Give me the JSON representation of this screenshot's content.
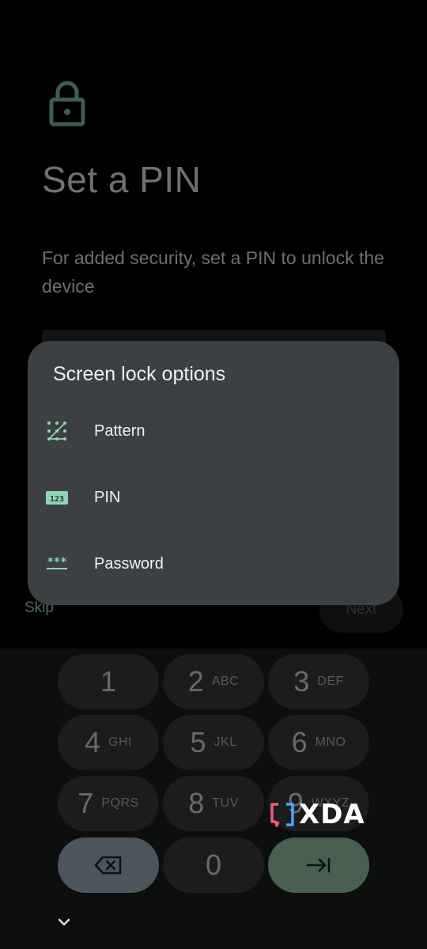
{
  "page": {
    "title": "Set a PIN",
    "description": "For added security, set a PIN to unlock the device",
    "skip_label": "Skip",
    "next_label": "Next"
  },
  "dialog": {
    "title": "Screen lock options",
    "options": [
      {
        "label": "Pattern",
        "icon": "pattern-icon"
      },
      {
        "label": "PIN",
        "icon": "pin-icon",
        "icon_text": "123"
      },
      {
        "label": "Password",
        "icon": "password-icon",
        "icon_text": "***"
      }
    ]
  },
  "keypad": {
    "keys": [
      {
        "digit": "1",
        "letters": ""
      },
      {
        "digit": "2",
        "letters": "ABC"
      },
      {
        "digit": "3",
        "letters": "DEF"
      },
      {
        "digit": "4",
        "letters": "GHI"
      },
      {
        "digit": "5",
        "letters": "JKL"
      },
      {
        "digit": "6",
        "letters": "MNO"
      },
      {
        "digit": "7",
        "letters": "PQRS"
      },
      {
        "digit": "8",
        "letters": "TUV"
      },
      {
        "digit": "9",
        "letters": "WXYZ"
      },
      {
        "digit": "0",
        "letters": ""
      }
    ]
  },
  "watermark": {
    "text": "XDA"
  },
  "colors": {
    "accent": "#8fd3b8",
    "dialog_bg": "#3c4042",
    "delete_key": "#4c555c",
    "enter_key": "#47604f"
  }
}
